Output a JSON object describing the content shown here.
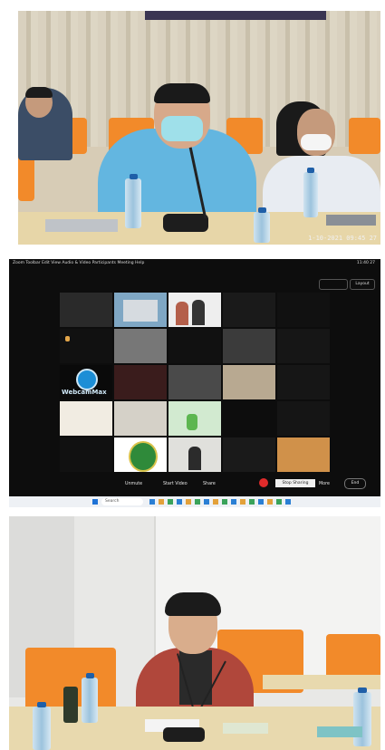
{
  "photo1": {
    "timestamp": "1-10-2021 09:45 27"
  },
  "zoom": {
    "menu": [
      "Zoom",
      "Toolbar",
      "Edit",
      "View",
      "Audio & Video",
      "Participants",
      "Meeting",
      "Help"
    ],
    "top_right": "11:40 27",
    "layout_button": "Layout",
    "tiles": {
      "webcammax_text": "WebcamMax"
    },
    "controls": {
      "unmute": "Unmute",
      "start_video": "Start Video",
      "share": "Share",
      "stop_share": "Stop Sharing",
      "end_wrap_label": "More",
      "end": "End"
    },
    "taskbar": {
      "search": "Search"
    }
  },
  "colors": {
    "chair": "#f28a2a",
    "shirt_blue": "#63b6e0",
    "cardigan": "#b0473b",
    "zoom_bg": "#0d0d0d",
    "end_red": "#e02b2b"
  }
}
